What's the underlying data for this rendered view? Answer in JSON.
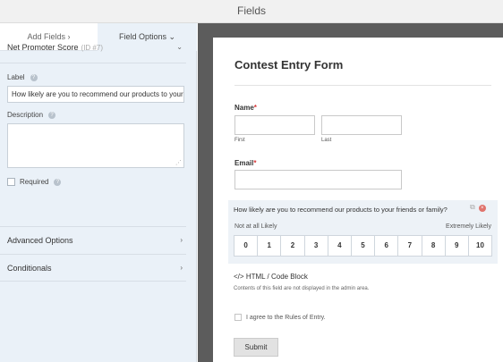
{
  "topbar": {
    "title": "Fields"
  },
  "tabs": {
    "add_fields": "Add Fields",
    "add_fields_chevron": "›",
    "field_options": "Field Options",
    "field_options_chevron": "⌄"
  },
  "field_options": {
    "field_name": "Net Promoter Score",
    "field_id": "(ID #7)",
    "label_label": "Label",
    "label_value": "How likely are you to recommend our products to your",
    "description_label": "Description",
    "description_value": "",
    "required_label": "Required",
    "required_checked": false,
    "advanced_options": "Advanced Options",
    "conditionals": "Conditionals"
  },
  "form": {
    "title": "Contest Entry Form",
    "name_label": "Name",
    "name_required_mark": "*",
    "first_sublabel": "First",
    "last_sublabel": "Last",
    "email_label": "Email",
    "email_required_mark": "*",
    "nps_question": "How likely are you to recommend our products to your friends or family?",
    "nps_low_label": "Not at all Likely",
    "nps_high_label": "Extremely Likely",
    "nps_scale": [
      "0",
      "1",
      "2",
      "3",
      "4",
      "5",
      "6",
      "7",
      "8",
      "9",
      "10"
    ],
    "html_block_title": "HTML / Code Block",
    "html_block_icon_text": "</>",
    "html_block_desc": "Contents of this field are not displayed in the admin area.",
    "agree_label": "I agree to the Rules of Entry.",
    "agree_checked": false,
    "submit_label": "Submit"
  },
  "colors": {
    "left_panel_bg": "#eaf1f8",
    "preview_bg": "#5c5c5c",
    "required_star": "#d63638",
    "delete_icon": "#e0736c",
    "nps_highlight_bg": "#edf2f7"
  },
  "icons": {
    "help": "question-circle-icon",
    "chevron_down": "chevron-down-icon",
    "chevron_right": "chevron-right-icon",
    "copy": "duplicate-icon",
    "delete": "delete-icon",
    "code": "code-icon",
    "resize": "resize-grip-icon"
  }
}
